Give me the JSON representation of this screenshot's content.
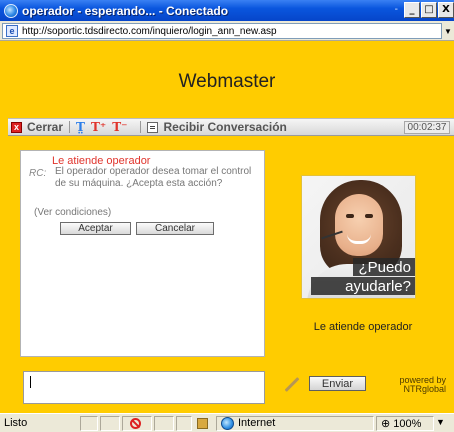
{
  "window": {
    "title": "operador - esperando... - Conectado",
    "controls": {
      "minimize": "_",
      "maximize": "□",
      "close": "X"
    }
  },
  "address": {
    "url": "http://soportic.tdsdirecto.com/inquiero/login_ann_new.asp"
  },
  "header": {
    "title": "Webmaster"
  },
  "toolbar": {
    "close_label": "Cerrar",
    "receive_label": "Recibir Conversación",
    "timer": "00:02:37",
    "icons": [
      "font-size-icon",
      "font-increase-icon",
      "font-decrease-icon",
      "receive-icon"
    ]
  },
  "chat": {
    "heading": "Le atiende operador",
    "sender": "RC:",
    "message": "El operador operador desea tomar el control de su máquina. ¿Acepta esta acción?",
    "link": "(Ver condiciones)",
    "accept_label": "Aceptar",
    "cancel_label": "Cancelar"
  },
  "photo": {
    "caption_line1": "¿Puedo",
    "caption_line2": "ayudarle?"
  },
  "operator_label": "Le atiende operador",
  "input": {
    "send_label": "Enviar",
    "powered_line1": "powered by",
    "powered_line2": "NTRglobal"
  },
  "status": {
    "text": "Listo",
    "zone": "Internet",
    "zoom": "100%"
  },
  "colors": {
    "page_bg": "#ffcc00",
    "title_bar": "#0a56de",
    "accent_red": "#e0342c"
  }
}
